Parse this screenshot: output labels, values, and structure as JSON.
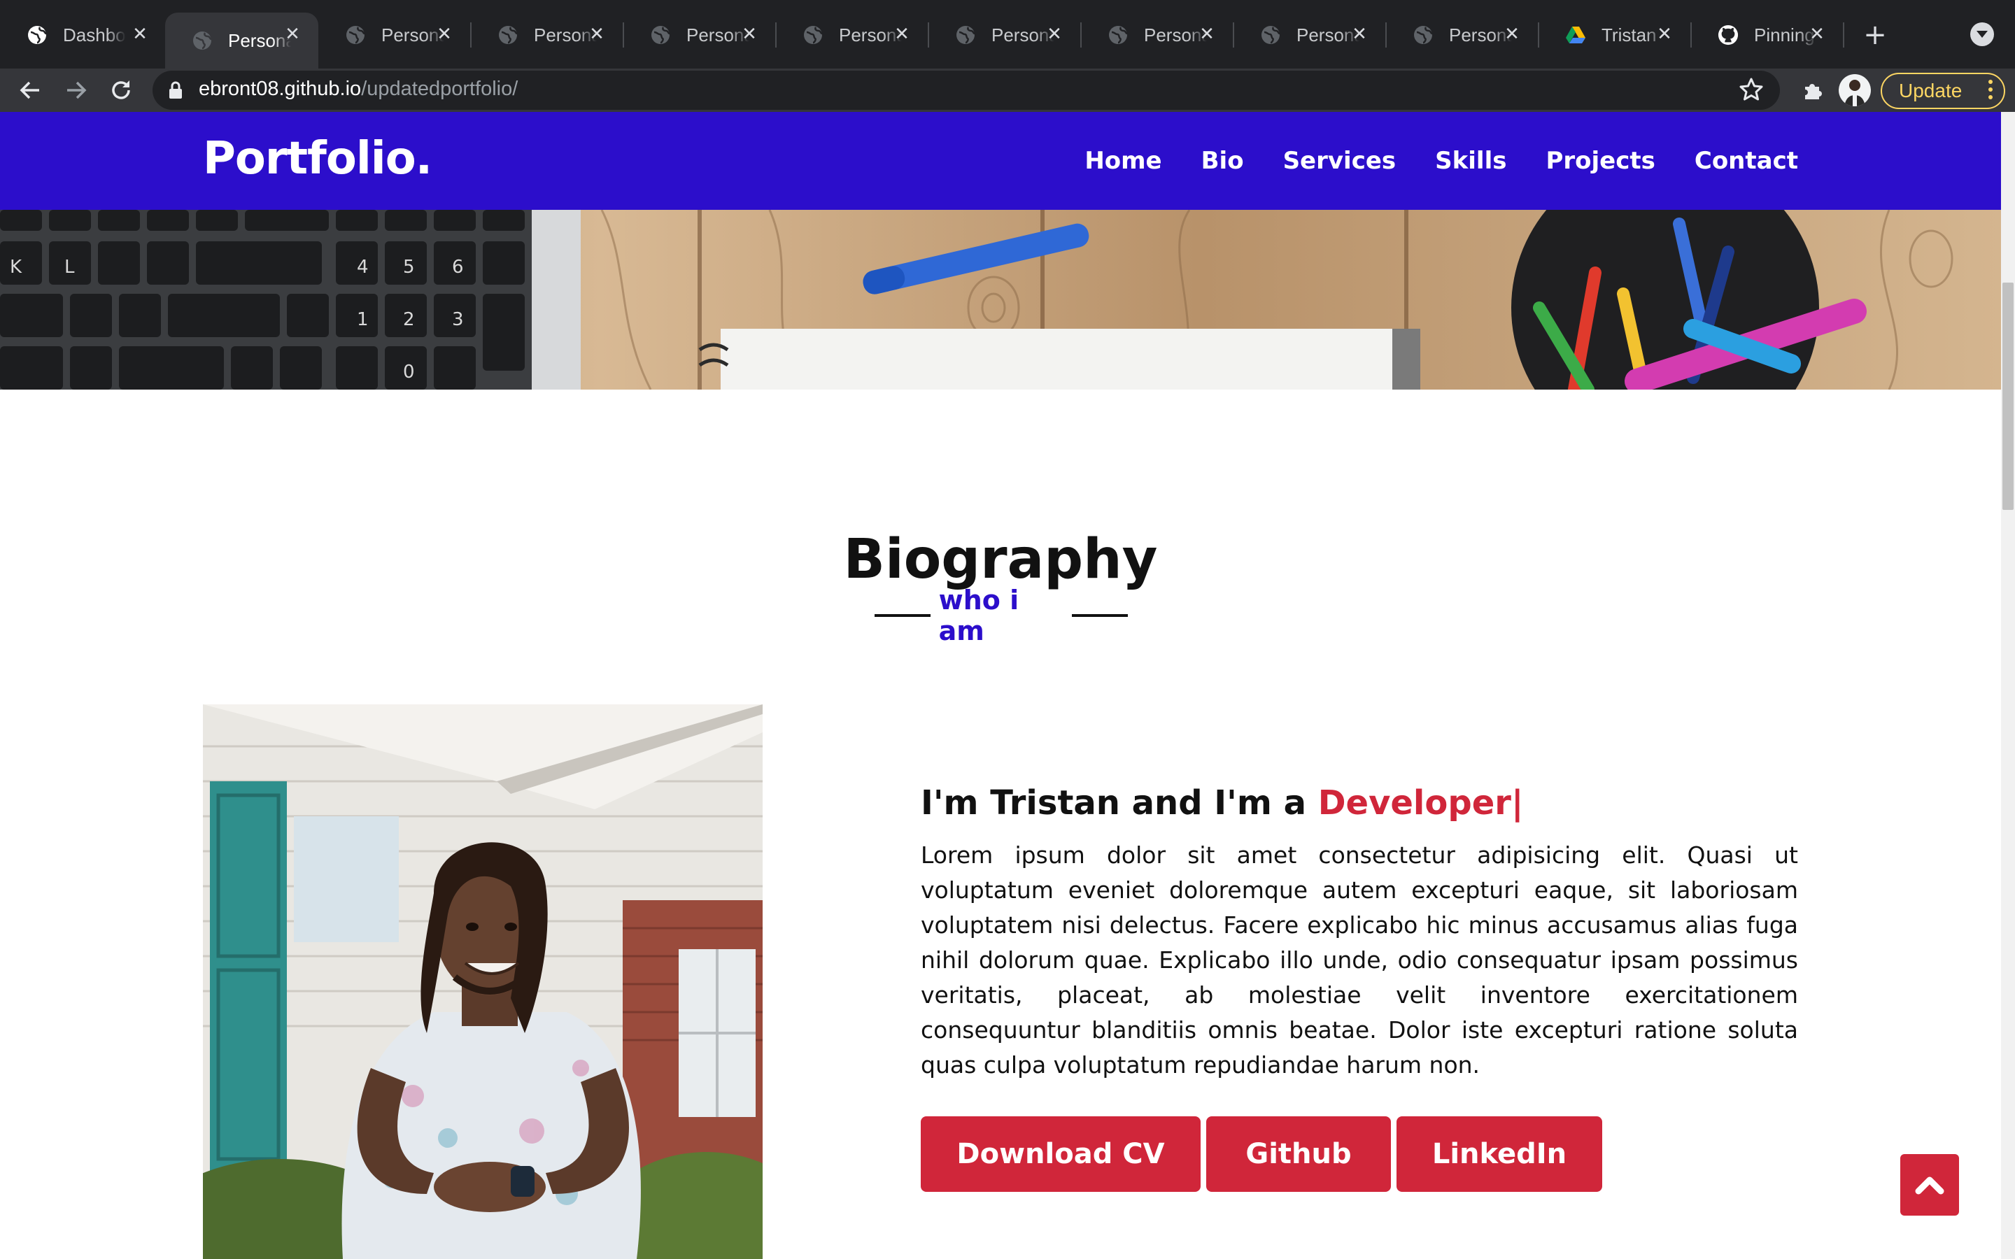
{
  "browser": {
    "tabs": [
      {
        "label": "Dashboard",
        "icon": "globe-icon",
        "active": false
      },
      {
        "label": "Personal",
        "icon": "globe-icon",
        "active": true
      },
      {
        "label": "Personal",
        "icon": "globe-icon",
        "active": false
      },
      {
        "label": "Personal",
        "icon": "globe-icon",
        "active": false
      },
      {
        "label": "Personal",
        "icon": "globe-icon",
        "active": false
      },
      {
        "label": "Personal",
        "icon": "globe-icon",
        "active": false
      },
      {
        "label": "Personal",
        "icon": "globe-icon",
        "active": false
      },
      {
        "label": "Personal",
        "icon": "globe-icon",
        "active": false
      },
      {
        "label": "Personal",
        "icon": "globe-icon",
        "active": false
      },
      {
        "label": "Personal",
        "icon": "globe-icon",
        "active": false
      },
      {
        "label": "Tristan",
        "icon": "google-drive-icon",
        "active": false
      },
      {
        "label": "Pinning",
        "icon": "github-icon",
        "active": false
      }
    ],
    "url_host": "ebront08.github.io",
    "url_path": "/updatedportfolio/",
    "update_label": "Update"
  },
  "site": {
    "logo": "Portfolio.",
    "nav": [
      "Home",
      "Bio",
      "Services",
      "Skills",
      "Projects",
      "Contact"
    ]
  },
  "biography": {
    "title": "Biography",
    "subtitle": "who i am",
    "headline_prefix": "I'm Tristan and I'm a ",
    "headline_typed": "Developer|",
    "paragraph": "Lorem ipsum dolor sit amet consectetur adipisicing elit. Quasi ut voluptatum eveniet doloremque autem excepturi eaque, sit laboriosam voluptatem nisi delectus. Facere explicabo hic minus accusamus alias fuga nihil dolorum quae. Explicabo illo unde, odio consequatur ipsam possimus veritatis, placeat, ab molestiae velit inventore exercitationem consequuntur blanditiis omnis beatae. Dolor iste excepturi ratione soluta quas culpa voluptatum repudiandae harum non.",
    "buttons": [
      "Download CV",
      "Github",
      "LinkedIn"
    ]
  },
  "colors": {
    "nav_bg": "#2c0ecb",
    "accent_red": "#d0263a",
    "chrome_dark": "#202124"
  }
}
